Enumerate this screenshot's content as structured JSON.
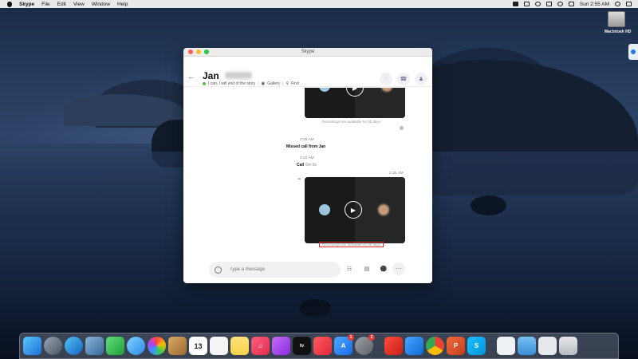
{
  "menubar": {
    "app": "Skype",
    "items": [
      "File",
      "Edit",
      "View",
      "Window",
      "Help"
    ],
    "clock": "Sun 2:55 AM"
  },
  "desktop": {
    "drive_label": "Macintosh HD"
  },
  "window": {
    "title": "Skype"
  },
  "chat": {
    "contact_name": "Jan",
    "status": "I can, I will end of the story",
    "gallery_label": "Gallery",
    "find_label": "Find"
  },
  "messages": {
    "recording_note_top": "Recordings are available for 30 days",
    "time_1": "2:09 AM",
    "missed_call": "Missed call from Jan",
    "time_2": "2:10 AM",
    "call_label": "Call",
    "call_duration": "6m 6s",
    "time_3": "2:15 AM",
    "recording_note_main": "Recordings are available for 30 days"
  },
  "composer": {
    "placeholder": "Type a message"
  },
  "dock": {
    "calendar_day": "13",
    "appstore_badge": "1",
    "prefs_badge": "2",
    "tv_label": "tv"
  },
  "colors": {
    "skype_blue": "#00aff0",
    "highlight_red": "#e22222",
    "online_green": "#5bb84a"
  }
}
